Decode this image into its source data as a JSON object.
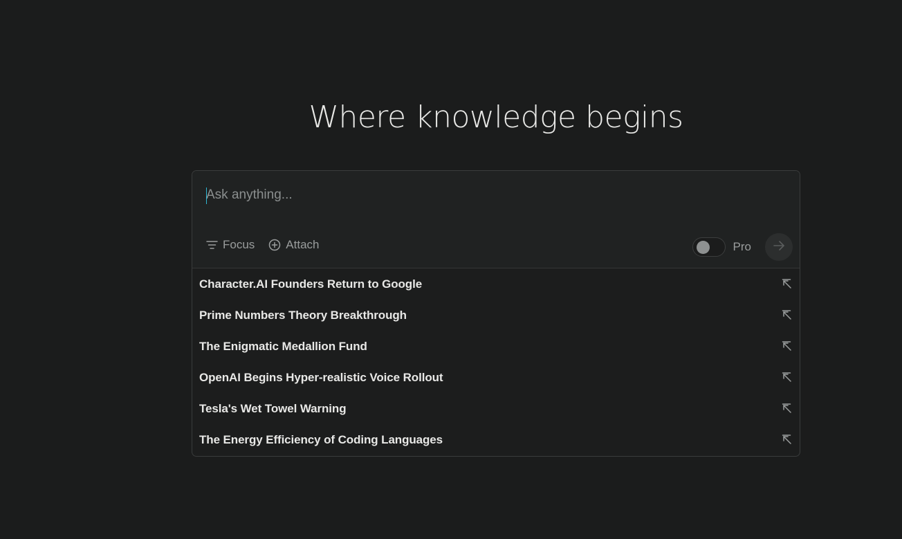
{
  "hero": {
    "title": "Where knowledge begins"
  },
  "search": {
    "placeholder": "Ask anything...",
    "value": ""
  },
  "toolbar": {
    "focus_label": "Focus",
    "attach_label": "Attach",
    "pro_label": "Pro",
    "pro_enabled": false
  },
  "suggestions": [
    {
      "label": "Character.AI Founders Return to Google"
    },
    {
      "label": "Prime Numbers Theory Breakthrough"
    },
    {
      "label": "The Enigmatic Medallion Fund"
    },
    {
      "label": "OpenAI Begins Hyper-realistic Voice Rollout"
    },
    {
      "label": "Tesla's Wet Towel Warning"
    },
    {
      "label": "The Energy Efficiency of Coding Languages"
    }
  ],
  "icons": {
    "focus": "filter-lines-icon",
    "attach": "plus-circle-icon",
    "submit": "arrow-right-icon",
    "suggestion": "arrow-up-left-icon"
  },
  "colors": {
    "background": "#1b1c1c",
    "accent_caret": "#2fb8d4",
    "text_primary": "#e8e8e6",
    "text_muted": "#9a9d9d"
  }
}
